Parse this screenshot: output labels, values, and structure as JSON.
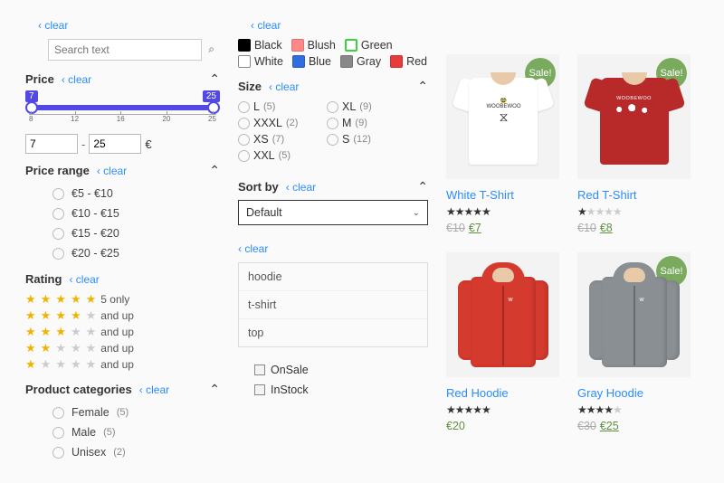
{
  "clear_label": "clear",
  "search": {
    "placeholder": "Search text"
  },
  "price": {
    "title": "Price",
    "min": 7,
    "max": 25,
    "ticks": [
      "8",
      "12",
      "16",
      "20",
      "25"
    ],
    "currency": "€"
  },
  "price_range": {
    "title": "Price range",
    "items": [
      "€5 - €10",
      "€10 - €15",
      "€15 - €20",
      "€20 - €25"
    ]
  },
  "rating": {
    "title": "Rating",
    "rows": [
      {
        "stars": 5,
        "label": "5 only"
      },
      {
        "stars": 4,
        "label": "and up"
      },
      {
        "stars": 3,
        "label": "and up"
      },
      {
        "stars": 2,
        "label": "and up"
      },
      {
        "stars": 1,
        "label": "and up"
      }
    ]
  },
  "categories": {
    "title": "Product categories",
    "items": [
      {
        "label": "Female",
        "count": "(5)"
      },
      {
        "label": "Male",
        "count": "(5)"
      },
      {
        "label": "Unisex",
        "count": "(2)"
      }
    ]
  },
  "colors": {
    "items": [
      {
        "label": "Black",
        "cls": "sw-black"
      },
      {
        "label": "Blush",
        "cls": "sw-blush"
      },
      {
        "label": "Green",
        "cls": "sw-green"
      },
      {
        "label": "White",
        "cls": "sw-white"
      },
      {
        "label": "Blue",
        "cls": "sw-blue"
      },
      {
        "label": "Gray",
        "cls": "sw-gray"
      },
      {
        "label": "Red",
        "cls": "sw-red"
      }
    ]
  },
  "size": {
    "title": "Size",
    "items": [
      {
        "label": "L",
        "count": "(5)"
      },
      {
        "label": "XL",
        "count": "(9)"
      },
      {
        "label": "XXXL",
        "count": "(2)"
      },
      {
        "label": "M",
        "count": "(9)"
      },
      {
        "label": "XS",
        "count": "(7)"
      },
      {
        "label": "S",
        "count": "(12)"
      },
      {
        "label": "XXL",
        "count": "(5)"
      }
    ]
  },
  "sort": {
    "title": "Sort by",
    "selected": "Default"
  },
  "terms": [
    "hoodie",
    "t-shirt",
    "top"
  ],
  "stock": {
    "onsale": "OnSale",
    "instock": "InStock"
  },
  "sale_badge": "Sale!",
  "products": [
    {
      "name": "White T-Shirt",
      "stars": 5,
      "old": "€10",
      "new": "€7"
    },
    {
      "name": "Red T-Shirt",
      "stars": 1,
      "old": "€10",
      "new": "€8"
    },
    {
      "name": "Red Hoodie",
      "stars": 5,
      "price": "€20"
    },
    {
      "name": "Gray Hoodie",
      "stars": 4,
      "old": "€30",
      "new": "€25"
    }
  ]
}
